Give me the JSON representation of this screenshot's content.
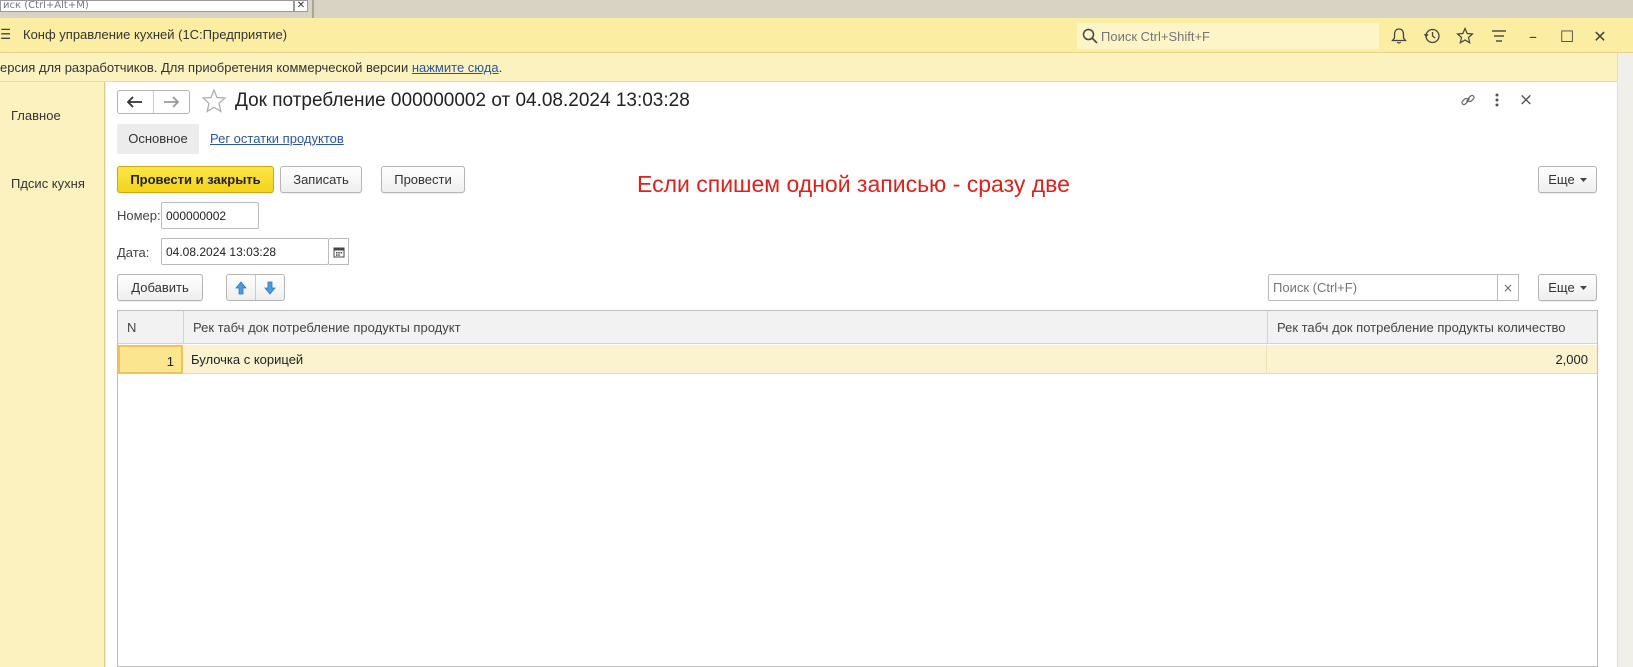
{
  "background_window": {
    "search_placeholder": "иск (Ctrl+Alt+M)",
    "close_glyph": "✕"
  },
  "titlebar": {
    "menu_glyph": "☰",
    "title": "Конф управление кухней  (1С:Предприятие)",
    "search_placeholder": "Поиск Ctrl+Shift+F",
    "minimize_glyph": "–",
    "maximize_glyph": "☐",
    "close_glyph": "✕"
  },
  "notice": {
    "text": "ерсия для разработчиков. Для приобретения коммерческой версии ",
    "link": "нажмите сюда",
    "suffix": "."
  },
  "sidebar": {
    "items": [
      {
        "label": "Главное"
      },
      {
        "label": "Пдсис кухня"
      }
    ]
  },
  "document": {
    "title": "Док потребление 000000002 от 04.08.2024 13:03:28",
    "close_glyph": "×",
    "tabs": [
      {
        "label": "Основное",
        "active": true
      },
      {
        "label": "Рег остатки продуктов",
        "active": false
      }
    ]
  },
  "toolbar": {
    "post_and_close": "Провести и закрыть",
    "save": "Записать",
    "post": "Провести",
    "more": "Еще"
  },
  "annotation": {
    "text": "Если спишем одной записью - сразу две",
    "color": "#e0201a"
  },
  "fields": {
    "number_label": "Номер:",
    "number_value": "000000002",
    "date_label": "Дата:",
    "date_value": "04.08.2024 13:03:28"
  },
  "table_toolbar": {
    "add": "Добавить",
    "search_placeholder": "Поиск (Ctrl+F)",
    "clear_glyph": "×",
    "more": "Еще"
  },
  "table": {
    "columns": [
      "N",
      "Рек табч док потребление продукты продукт",
      "Рек табч док потребление продукты количество"
    ],
    "rows": [
      {
        "n": "1",
        "product": "Булочка с корицей",
        "qty": "2,000"
      }
    ]
  },
  "colors": {
    "accent_yellow": "#f4d31a",
    "title_bar": "#fbeea2",
    "link": "#2a55a0"
  }
}
